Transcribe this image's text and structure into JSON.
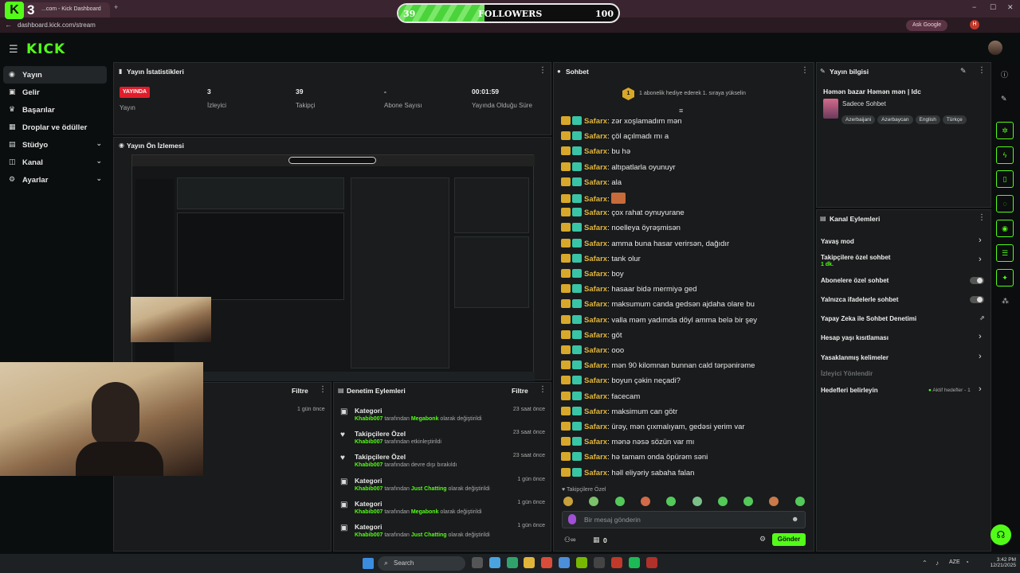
{
  "browser": {
    "tab_title": "...com - Kick Dashboard",
    "new_tab": "+",
    "url": "dashboard.kick.com/stream",
    "ask_google": "Ask Google",
    "profile_initial": "H",
    "minimize": "−",
    "maximize": "☐",
    "close": "✕"
  },
  "overlay": {
    "logo_letter": "K",
    "number": "3"
  },
  "followers": {
    "current": "39",
    "label": "FOLLOWERS",
    "goal": "100",
    "progress": 0.39
  },
  "app": {
    "logo": "KICK"
  },
  "sidebar": {
    "items": [
      {
        "label": "Yayın",
        "icon": "broadcast-icon"
      },
      {
        "label": "Gelir",
        "icon": "money-icon"
      },
      {
        "label": "Başarılar",
        "icon": "trophy-icon"
      },
      {
        "label": "Droplar ve ödüller",
        "icon": "gift-icon"
      },
      {
        "label": "Stüdyo",
        "icon": "studio-icon"
      },
      {
        "label": "Kanal",
        "icon": "channel-icon"
      },
      {
        "label": "Ayarlar",
        "icon": "gear-icon"
      }
    ]
  },
  "stats": {
    "title": "Yayın İstatistikleri",
    "live_badge": "YAYINDA",
    "live_label": "Yayın",
    "items": [
      {
        "value": "3",
        "label": "İzleyici"
      },
      {
        "value": "39",
        "label": "Takipçi"
      },
      {
        "value": "-",
        "label": "Abone Sayısı"
      },
      {
        "value": "00:01:59",
        "label": "Yayında Olduğu Süre"
      }
    ]
  },
  "preview": {
    "title": "Yayın Ön İzlemesi"
  },
  "partial_panel": {
    "filter": "Filtre",
    "time": "1 gün önce"
  },
  "audit": {
    "title": "Denetim Eylemleri",
    "filter": "Filtre",
    "rows": [
      {
        "title": "Kategori",
        "user": "Khabib007",
        "mid": "tarafından",
        "extra": "Megabonk",
        "tail": "olarak değiştirildi",
        "time": "23 saat önce"
      },
      {
        "title": "Takipçilere Özel",
        "user": "Khabib007",
        "mid": "tarafından etkinleştirildi",
        "extra": "",
        "tail": "",
        "time": "23 saat önce"
      },
      {
        "title": "Takipçilere Özel",
        "user": "Khabib007",
        "mid": "tarafından devre dışı bırakıldı",
        "extra": "",
        "tail": "",
        "time": "23 saat önce"
      },
      {
        "title": "Kategori",
        "user": "Khabib007",
        "mid": "tarafından",
        "extra": "Just Chatting",
        "tail": "olarak değiştirildi",
        "time": "1 gün önce"
      },
      {
        "title": "Kategori",
        "user": "Khabib007",
        "mid": "tarafından",
        "extra": "Megabonk",
        "tail": "olarak değiştirildi",
        "time": "1 gün önce"
      },
      {
        "title": "Kategori",
        "user": "Khabib007",
        "mid": "tarafından",
        "extra": "Just Chatting",
        "tail": "olarak değiştirildi",
        "time": "1 gün önce"
      }
    ]
  },
  "chat": {
    "title": "Sohbet",
    "pinned": "1 abonelik hediye ederek 1. sıraya yükselin",
    "pinned_rank": "1",
    "messages": [
      {
        "user": "Safarx",
        "text": "zər xoşlamadım mən"
      },
      {
        "user": "Safarx",
        "text": "çöl açılmadı mı a"
      },
      {
        "user": "Safarx",
        "text": "bu hə"
      },
      {
        "user": "Safarx",
        "text": "altıpatlarla oyunuyr"
      },
      {
        "user": "Safarx",
        "text": "ala"
      },
      {
        "user": "Safarx",
        "text": ""
      },
      {
        "user": "Safarx",
        "text": "çox rahat oynuyurane"
      },
      {
        "user": "Safarx",
        "text": "noelleya öyrəşmisən"
      },
      {
        "user": "Safarx",
        "text": "amma buna hasar verirsən, dağıdır"
      },
      {
        "user": "Safarx",
        "text": "tank olur"
      },
      {
        "user": "Safarx",
        "text": "boy"
      },
      {
        "user": "Safarx",
        "text": "hasaar bidə mermiyə ged"
      },
      {
        "user": "Safarx",
        "text": "maksumum canda gedsən ajdaha olare bu"
      },
      {
        "user": "Safarx",
        "text": "valla məm yadımda döyl amma belə bir şey"
      },
      {
        "user": "Safarx",
        "text": "göt"
      },
      {
        "user": "Safarx",
        "text": "ooo"
      },
      {
        "user": "Safarx",
        "text": "mən 90 kilomnan bunnan cald tərpənirəme"
      },
      {
        "user": "Safarx",
        "text": "boyun çəkin neçadi?"
      },
      {
        "user": "Safarx",
        "text": "facecam"
      },
      {
        "user": "Safarx",
        "text": "maksimum can götr"
      },
      {
        "user": "Safarx",
        "text": "ürəy, mən çıxmalıyam, gedəsi yerim var"
      },
      {
        "user": "Safarx",
        "text": "mənə nəsə sözün var mı"
      },
      {
        "user": "Safarx",
        "text": "hə tamam onda öpürəm səni"
      },
      {
        "user": "Safarx",
        "text": "həll eliyəriy sabaha falan"
      }
    ],
    "followers_only": "Takipçilere Özel",
    "input_placeholder": "Bir mesaj gönderin",
    "count": "0",
    "send": "Gönder"
  },
  "stream_info": {
    "title": "Yayın bilgisi",
    "stream_title": "Həmən bazar Həmən mən | Idc",
    "category": "Sadece Sohbet",
    "tags": [
      "Azerbaijani",
      "Azərbaycan",
      "English",
      "Türkçe"
    ]
  },
  "channel_actions": {
    "title": "Kanal Eylemleri",
    "rows": [
      {
        "label": "Yavaş mod",
        "control": "chevron"
      },
      {
        "label": "Takipçilere özel sohbet",
        "sub": "1 dk.",
        "control": "chevron"
      },
      {
        "label": "Abonelere özel sohbet",
        "control": "toggle"
      },
      {
        "label": "Yalnızca ifadelerle sohbet",
        "control": "toggle"
      },
      {
        "label": "Yapay Zeka ile Sohbet Denetimi",
        "control": "external"
      },
      {
        "label": "Hesap yaşı kısıtlaması",
        "control": "chevron"
      },
      {
        "label": "Yasaklanmış kelimeler",
        "control": "chevron"
      },
      {
        "label": "İzleyici Yönlendir",
        "control": "none"
      },
      {
        "label": "Hedefleri belirleyin",
        "control": "chevron",
        "status": "Aktif hedefler - 1"
      }
    ]
  },
  "taskbar": {
    "search": "Search",
    "lang": "AZE",
    "time": "3:42 PM",
    "date": "12/21/2025"
  },
  "colors": {
    "accent": "#53fc18",
    "chat_name": "#e2b53b",
    "live": "#e11d2b"
  }
}
